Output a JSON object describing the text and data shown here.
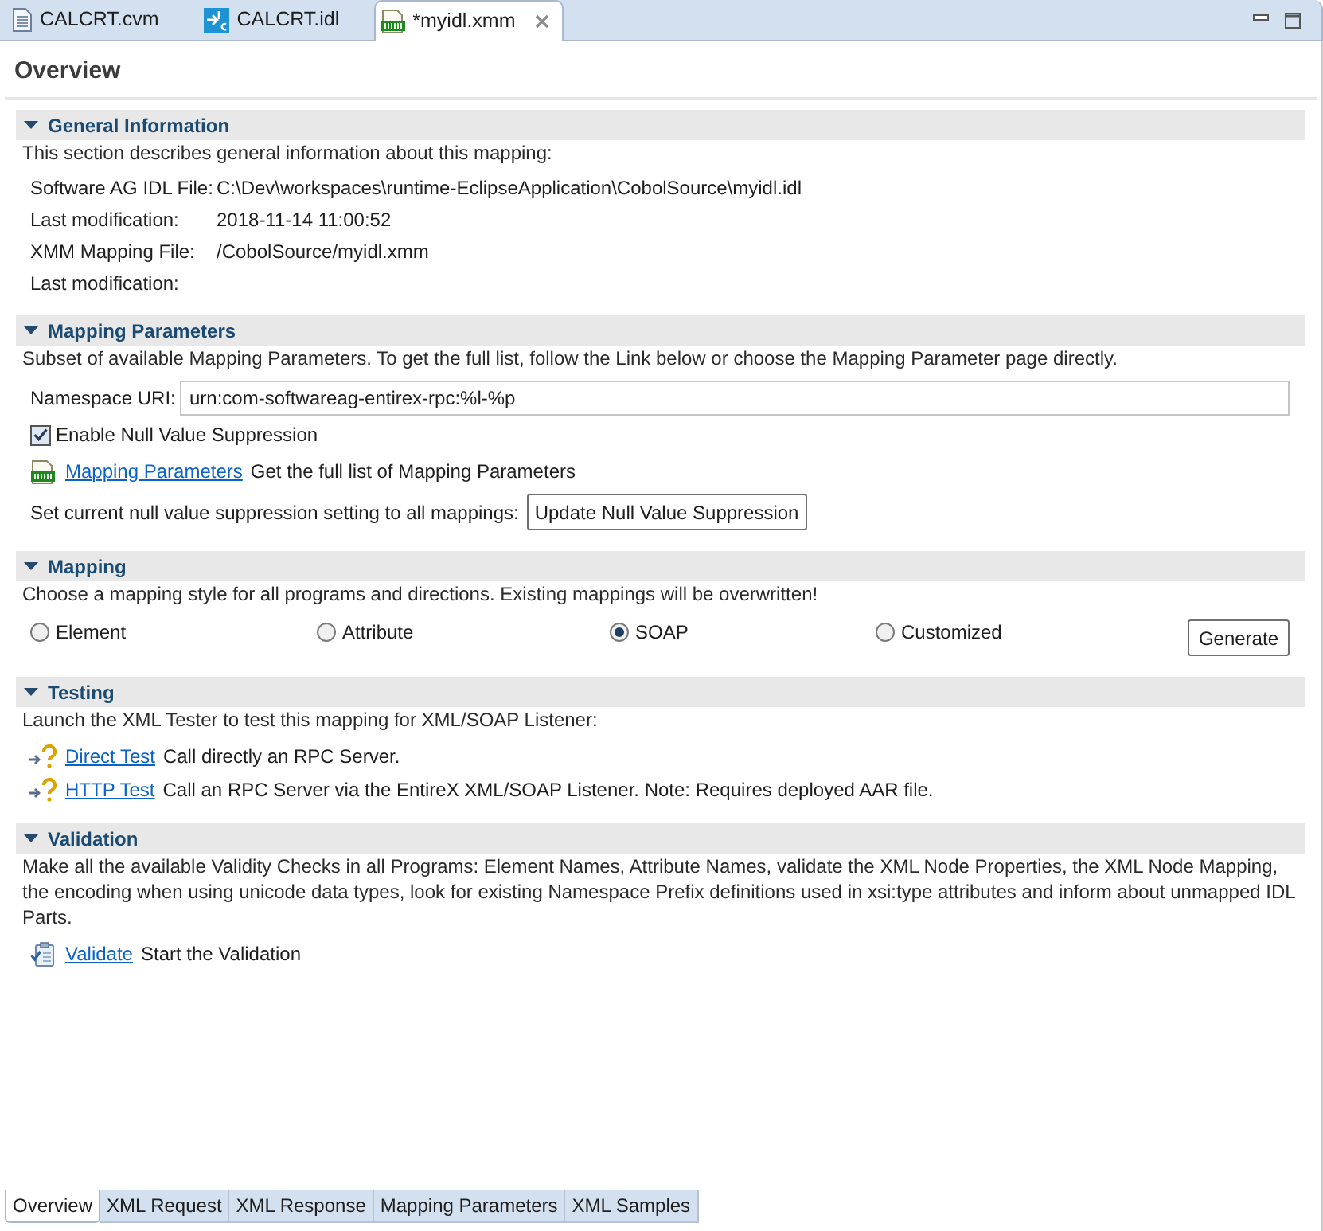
{
  "editor_tabs": [
    {
      "label": "CALCRT.cvm",
      "kind": "document",
      "selected": false
    },
    {
      "label": "CALCRT.idl",
      "kind": "idl",
      "selected": false
    },
    {
      "label": "*myidl.xmm",
      "kind": "xmm",
      "selected": true
    }
  ],
  "page_title": "Overview",
  "sections": [
    {
      "kind": "info",
      "title": "General Information",
      "expanded": true,
      "description": "This section describes general information about this mapping:",
      "fields": [
        {
          "label": "Software AG IDL File:",
          "value": "C:\\Dev\\workspaces\\runtime-EclipseApplication\\CobolSource\\myidl.idl"
        },
        {
          "label": "Last modification:",
          "value": "2018-11-14 11:00:52"
        },
        {
          "label": "XMM Mapping File:",
          "value": "/CobolSource/myidl.xmm"
        },
        {
          "label": "Last modification:"
        }
      ]
    },
    {
      "kind": "parameters",
      "title": "Mapping Parameters",
      "expanded": true,
      "description": "Subset of available Mapping Parameters. To get the full list, follow the Link below or choose the Mapping Parameter page directly.",
      "namespace_field": {
        "label": "Namespace URI:",
        "value": "urn:com-softwareag-entirex-rpc:%l-%p"
      },
      "checkbox": {
        "label": "Enable Null Value Suppression",
        "checked": true
      },
      "links": [
        {
          "kind": "xmm",
          "label": "Mapping Parameters",
          "description": "Get the full list of Mapping Parameters"
        }
      ],
      "action": {
        "label": "Set current null value suppression setting to all mappings:",
        "button": "Update Null Value Suppression"
      }
    },
    {
      "kind": "styles",
      "title": "Mapping",
      "expanded": true,
      "description": "Choose a mapping style for all programs and directions. Existing mappings will be overwritten!",
      "options": [
        {
          "label": "Element",
          "selected": false
        },
        {
          "label": "Attribute",
          "selected": false
        },
        {
          "label": "SOAP",
          "selected": true
        },
        {
          "label": "Customized",
          "selected": false
        }
      ],
      "button": "Generate"
    },
    {
      "kind": "links",
      "title": "Testing",
      "expanded": true,
      "description": "Launch the XML Tester to test this mapping for XML/SOAP Listener:",
      "links": [
        {
          "kind": "test",
          "label": "Direct Test",
          "description": "Call directly an RPC Server."
        },
        {
          "kind": "test",
          "label": "HTTP Test",
          "description": "Call an RPC Server via the EntireX XML/SOAP Listener. Note: Requires deployed AAR file."
        }
      ]
    },
    {
      "kind": "links",
      "title": "Validation",
      "expanded": true,
      "description": "Make all the available Validity Checks in all Programs: Element Names, Attribute Names, validate the XML Node Properties, the XML Node Mapping, the encoding when using unicode data types, look for existing Namespace Prefix definitions used in xsi:type attributes and inform about unmapped IDL Parts.",
      "links": [
        {
          "kind": "validate",
          "label": "Validate",
          "description": "Start the Validation"
        }
      ]
    }
  ],
  "page_tabs": [
    {
      "label": "Overview",
      "selected": true
    },
    {
      "label": "XML Request",
      "selected": false
    },
    {
      "label": "XML Response",
      "selected": false
    },
    {
      "label": "Mapping Parameters",
      "selected": false
    },
    {
      "label": "XML Samples",
      "selected": false
    }
  ]
}
